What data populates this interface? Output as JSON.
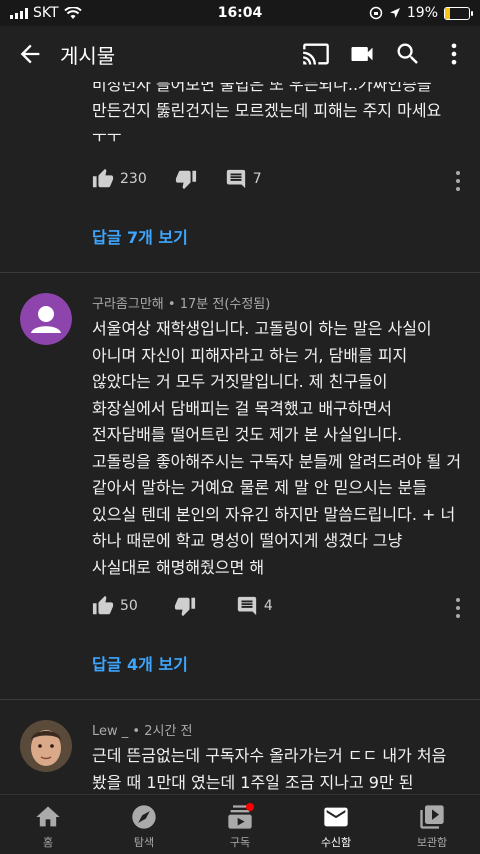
{
  "status_bar": {
    "carrier": "SKT",
    "time": "16:04",
    "battery": "19%",
    "battery_level": 0.19
  },
  "app_bar": {
    "title": "게시물"
  },
  "prev_comment": {
    "tail_lines": [
      "비성년자 틀어보면 불법은 또 우는되나..가짜인승들",
      "만든건지 뚫린건지는 모르겠는데 피해는 주지 마세요",
      "ㅜㅜ"
    ],
    "likes": "230",
    "replies_count": "7",
    "replies_link": "답글 7개 보기"
  },
  "comments": [
    {
      "author": "구라좀그만해",
      "time": "17분 전(수정됨)",
      "body": "서울여상 재학생입니다. 고돌링이 하는 말은 사실이 아니며 자신이 피해자라고 하는 거, 담배를 피지 않았다는 거 모두 거짓말입니다. 제 친구들이 화장실에서 담배피는 걸 목격했고 배구하면서 전자담배를 떨어트린 것도 제가 본 사실입니다. 고돌링을 좋아해주시는 구독자 분들께 알려드려야 될 거 같아서 말하는 거예요 물론 제 말 안 믿으시는 분들 있으실 텐데 본인의 자유긴 하지만 말씀드립니다. + 너 하나 때문에 학교 명성이 떨어지게 생겼다 그냥 사실대로 해명해줬으면 해",
      "likes": "50",
      "replies_count": "4",
      "replies_link": "답글 4개 보기"
    },
    {
      "author": "Lew _",
      "time": "2시간 전",
      "body": "근데 뜬금없는데 구독자수 올라가는거 ㄷㄷ 내가 처음 봤을 때 1만대 였는데 1주일 조금 지나고 9만 된"
    }
  ],
  "bottom_nav": [
    {
      "label": "홈",
      "icon": "home-icon"
    },
    {
      "label": "탐색",
      "icon": "explore-icon"
    },
    {
      "label": "구독",
      "icon": "subscriptions-icon"
    },
    {
      "label": "수신함",
      "icon": "inbox-icon",
      "active": true
    },
    {
      "label": "보관함",
      "icon": "library-icon"
    }
  ]
}
